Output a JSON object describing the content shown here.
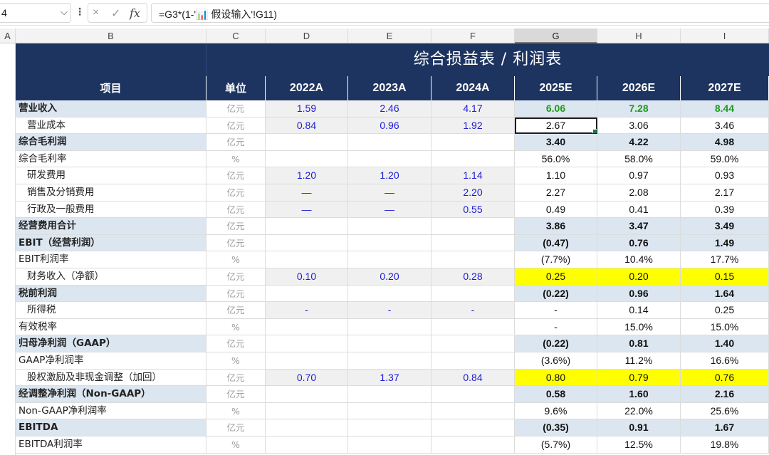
{
  "formula_bar": {
    "name_box": "4",
    "cancel_icon": "×",
    "enter_icon": "✓",
    "fx_label": "fx",
    "formula": "=G3*(1-'📊 假设输入'!G11)"
  },
  "columns": [
    "A",
    "B",
    "C",
    "D",
    "E",
    "F",
    "G",
    "H",
    "I"
  ],
  "sheet": {
    "title": "综合损益表 / 利润表",
    "headers": [
      "项目",
      "单位",
      "2022A",
      "2023A",
      "2024A",
      "2025E",
      "2026E",
      "2027E"
    ],
    "rows": [
      {
        "label": "营业收入",
        "unit": "亿元",
        "d": "1.59",
        "e": "2.46",
        "f": "4.17",
        "g": "6.06",
        "h": "7.28",
        "i": "8.44"
      },
      {
        "label": "营业成本",
        "unit": "亿元",
        "d": "0.84",
        "e": "0.96",
        "f": "1.92",
        "g": "2.67",
        "h": "3.06",
        "i": "3.46"
      },
      {
        "label": "综合毛利润",
        "unit": "亿元",
        "d": "",
        "e": "",
        "f": "",
        "g": "3.40",
        "h": "4.22",
        "i": "4.98"
      },
      {
        "label": "综合毛利率",
        "unit": "%",
        "d": "",
        "e": "",
        "f": "",
        "g": "56.0%",
        "h": "58.0%",
        "i": "59.0%"
      },
      {
        "label": "研发费用",
        "unit": "亿元",
        "d": "1.20",
        "e": "1.20",
        "f": "1.14",
        "g": "1.10",
        "h": "0.97",
        "i": "0.93"
      },
      {
        "label": "销售及分销费用",
        "unit": "亿元",
        "d": "—",
        "e": "—",
        "f": "2.20",
        "g": "2.27",
        "h": "2.08",
        "i": "2.17"
      },
      {
        "label": "行政及一般费用",
        "unit": "亿元",
        "d": "—",
        "e": "—",
        "f": "0.55",
        "g": "0.49",
        "h": "0.41",
        "i": "0.39"
      },
      {
        "label": "经营费用合计",
        "unit": "亿元",
        "d": "",
        "e": "",
        "f": "",
        "g": "3.86",
        "h": "3.47",
        "i": "3.49"
      },
      {
        "label": "EBIT（经营利润）",
        "unit": "亿元",
        "d": "",
        "e": "",
        "f": "",
        "g": "(0.47)",
        "h": "0.76",
        "i": "1.49"
      },
      {
        "label": "EBIT利润率",
        "unit": "%",
        "d": "",
        "e": "",
        "f": "",
        "g": "(7.7%)",
        "h": "10.4%",
        "i": "17.7%"
      },
      {
        "label": "财务收入（净额）",
        "unit": "亿元",
        "d": "0.10",
        "e": "0.20",
        "f": "0.28",
        "g": "0.25",
        "h": "0.20",
        "i": "0.15"
      },
      {
        "label": "税前利润",
        "unit": "亿元",
        "d": "",
        "e": "",
        "f": "",
        "g": "(0.22)",
        "h": "0.96",
        "i": "1.64"
      },
      {
        "label": "所得税",
        "unit": "亿元",
        "d": "-",
        "e": "-",
        "f": "-",
        "g": "-",
        "h": "0.14",
        "i": "0.25"
      },
      {
        "label": "有效税率",
        "unit": "%",
        "d": "",
        "e": "",
        "f": "",
        "g": "-",
        "h": "15.0%",
        "i": "15.0%"
      },
      {
        "label": "归母净利润（GAAP）",
        "unit": "亿元",
        "d": "",
        "e": "",
        "f": "",
        "g": "(0.22)",
        "h": "0.81",
        "i": "1.40"
      },
      {
        "label": "GAAP净利润率",
        "unit": "%",
        "d": "",
        "e": "",
        "f": "",
        "g": "(3.6%)",
        "h": "11.2%",
        "i": "16.6%"
      },
      {
        "label": "股权激励及非现金调整（加回）",
        "unit": "亿元",
        "d": "0.70",
        "e": "1.37",
        "f": "0.84",
        "g": "0.80",
        "h": "0.79",
        "i": "0.76"
      },
      {
        "label": "经调整净利润（Non-GAAP）",
        "unit": "亿元",
        "d": "",
        "e": "",
        "f": "",
        "g": "0.58",
        "h": "1.60",
        "i": "2.16"
      },
      {
        "label": "Non-GAAP净利润率",
        "unit": "%",
        "d": "",
        "e": "",
        "f": "",
        "g": "9.6%",
        "h": "22.0%",
        "i": "25.6%"
      },
      {
        "label": "EBITDA",
        "unit": "亿元",
        "d": "",
        "e": "",
        "f": "",
        "g": "(0.35)",
        "h": "0.91",
        "i": "1.67"
      },
      {
        "label": "EBITDA利润率",
        "unit": "%",
        "d": "",
        "e": "",
        "f": "",
        "g": "(5.7%)",
        "h": "12.5%",
        "i": "19.8%"
      }
    ]
  },
  "colors": {
    "header_navy": "#1d3461",
    "input_blue": "#1a1ad6",
    "revenue_green": "#1f9a1f",
    "highlight_yellow": "#ffff00",
    "subtotal_light_blue": "#dce6f1",
    "historical_gray": "#f0f0f0"
  }
}
